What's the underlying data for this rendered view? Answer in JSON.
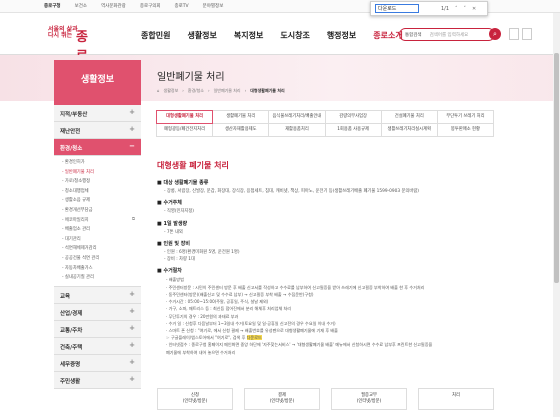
{
  "topbar": {
    "links": [
      "종로구청",
      "보건소",
      "역사문화관광",
      "종로구의회",
      "종로TV",
      "분야별정보"
    ]
  },
  "find": {
    "query": "다운로드",
    "count": "1/1",
    "prev": "˄",
    "next": "˅",
    "close": "✕"
  },
  "logo": {
    "line1": "서울의 삶과",
    "line2": "다시 뛰는",
    "big": "종로"
  },
  "gnb": [
    "종합민원",
    "생활정보",
    "복지정보",
    "도시창조",
    "행정정보",
    "종로소개"
  ],
  "search": {
    "scope": "통합검색",
    "placeholder": "검색어를 입력하세요"
  },
  "lnb": {
    "title": "생활정보",
    "menus_top": [
      {
        "label": "지적/부동산"
      },
      {
        "label": "재난안전"
      },
      {
        "label": "환경/청소"
      }
    ],
    "sub": [
      "환경인허가",
      "일반폐기물 처리",
      "가로/청소행정",
      "청소대행업체",
      "생활소음 규제",
      "환경개선부담금",
      "에코마일리지",
      "배출업소 관리",
      "대기관리",
      "석면해체제거감리",
      "공공건물 석면 관리",
      "자동차배출가스",
      "실내공기질 관리"
    ],
    "menus_bottom": [
      {
        "label": "교육"
      },
      {
        "label": "산업/경제"
      },
      {
        "label": "교통/주차"
      },
      {
        "label": "건축/주택"
      },
      {
        "label": "세무증명"
      },
      {
        "label": "주민생활"
      }
    ]
  },
  "page": {
    "title": "일반폐기물 처리",
    "breadcrumb": [
      "생활정보",
      "환경/청소",
      "일반폐기물 처리",
      "대형생활폐기물 처리"
    ]
  },
  "tabs": [
    [
      {
        "label": "대형생활폐기물 처리",
        "active": true
      },
      {
        "label": "생활폐기물 처리"
      },
      {
        "label": "음식물쓰레기처리/배출안내"
      },
      {
        "label": "감량의무사업장"
      },
      {
        "label": "건설폐기물 처리"
      },
      {
        "label": "무단투기 쓰레기 처리"
      }
    ],
    [
      {
        "label": "폐형광등/폐건전지처리"
      },
      {
        "label": "생산자재활용제도"
      },
      {
        "label": "재활용품처리"
      },
      {
        "label": "1회용품 사용규제"
      },
      {
        "label": "생활쓰레기처리실시계획"
      },
      {
        "label": "봉투판매소 현황"
      }
    ]
  ],
  "content": {
    "heading": "대형생활 폐기물 처리",
    "s1": {
      "title": "대상 생활폐기물 종류",
      "text": "- 장롱, 서랍장, 신발장, 문갑, 화장대, 장식장, 응접세트, 침대, 캐비넷, 책상, 피아노, 운전기 등(생활쓰레기배출 폐기물 1599-0903 문의바람)"
    },
    "s2": {
      "title": "수거주체",
      "text": "- 직영(민자지정)"
    },
    "s3": {
      "title": "1일 발생량",
      "text": "- 7톤 내외"
    },
    "s4": {
      "title": "인원 및 장비",
      "lines": [
        "- 인원 : 6명(환경미화원 5명, 운전원 1명)",
        "- 장비 : 차량 1대"
      ]
    },
    "s5": {
      "title": "수거절차",
      "lines": [
        "- 배출방법",
        "· 주민센터방문 : 시민이 주민센터 방문 후 배출 신고서를 작성하고 수수료를 납부하여 신고필증을 받아 쓰레기에 신고필증 부착하여 배출 한 후 수거처리",
        "· 동주민센터(방문)(배출신고 및 수수료 납부) → 신고필증 부착 배출 → 수집운반(구청)",
        "· 수거시간 : 05:00~15:00(주말, 공휴일, 주식, 설날 제외)",
        "· 가구, 소파, 매트리스 등 : 최신등 접어진에서 분리 해체후 처리업체 처리",
        "· 무단투기의 경우 : 20만원의 과태료 부과",
        "· 수거 일 : 신청후 다음날부터 1~3일내 수거(토요일 및 일·공휴일 신고전의 경우 수요일 이내 수거)",
        "· 스마트 폰 신청 : \"여기로, 에서 신청 결제 → 배출번호를 유성펜으로 대형생활폐기물에 기재 후 배출",
        "  ☞ 구글플레이/앱스토어에서 \"여기로\", 검색 후 ",
        "· 인터넷접수 : 종로구청 홈페이지 메인화면 중앙 하단에 '자주찾는서비스' → '대형생활폐기물 배출' 메뉴에서 신청하시면 수수료 납부후 프린트한 신고필증을",
        "  폐기물에 부착하여 내어 놓으면 수거처리"
      ],
      "hl": "다운로드"
    }
  },
  "flow": [
    {
      "l1": "신청",
      "l2": "(인터넷/방문)"
    },
    {
      "l1": "결제",
      "l2": "(인터넷/방문)"
    },
    {
      "l1": "필증교부",
      "l2": "(인터넷/방문)"
    },
    {
      "l1": "처리",
      "l2": ""
    }
  ]
}
